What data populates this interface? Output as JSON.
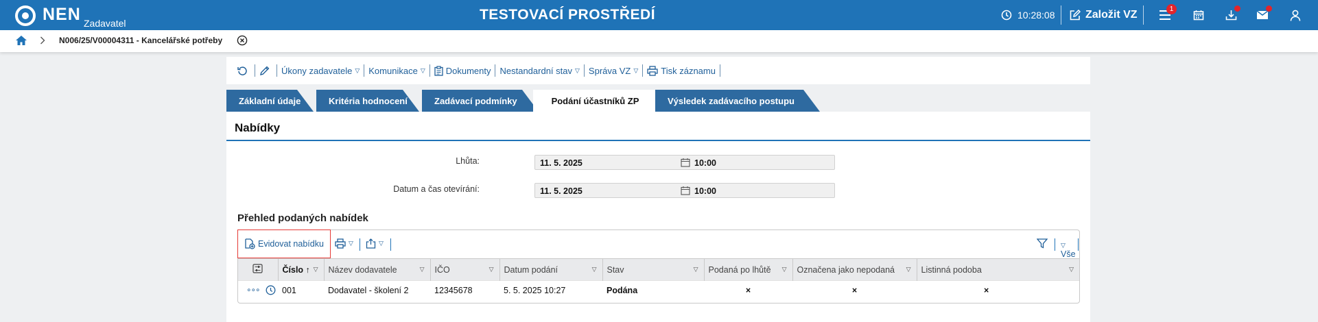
{
  "header": {
    "logo_text": "NEN",
    "logo_sub": "Zadavatel",
    "env_title": "TESTOVACÍ PROSTŘEDÍ",
    "clock": "10:28:08",
    "create_label": "Založit VZ",
    "menu_badge": "1"
  },
  "breadcrumb": {
    "text": "N006/25/V00004311 - Kancelářské potřeby"
  },
  "actions": {
    "ukony": "Úkony zadavatele",
    "komunikace": "Komunikace",
    "dokumenty": "Dokumenty",
    "nestandardni": "Nestandardní stav",
    "sprava": "Správa VZ",
    "tisk": "Tisk záznamu"
  },
  "tabs": [
    {
      "label": "Základní údaje"
    },
    {
      "label": "Kritéria hodnocení"
    },
    {
      "label": "Zadávací podmínky"
    },
    {
      "label": "Podání účastníků ZP",
      "active": true
    },
    {
      "label": "Výsledek zadávacího postupu"
    }
  ],
  "section": {
    "title": "Nabídky",
    "lhuta_label": "Lhůta:",
    "lhuta_date": "11. 5. 2025",
    "lhuta_time": "10:00",
    "otevirani_label": "Datum a čas otevírání:",
    "otevirani_date": "11. 5. 2025",
    "otevirani_time": "10:00"
  },
  "offers": {
    "title": "Přehled podaných nabídek",
    "add_label": "Evidovat nabídku",
    "filter_all": "Vše",
    "columns": [
      "Číslo",
      "Název dodavatele",
      "IČO",
      "Datum podání",
      "Stav",
      "Podaná po lhůtě",
      "Označena jako nepodaná",
      "Listinná podoba"
    ],
    "rows": [
      {
        "cislo": "001",
        "dodavatel": "Dodavatel - školení 2",
        "ico": "12345678",
        "datum": "5. 5. 2025 10:27",
        "stav": "Podána",
        "po_lhute": "×",
        "nepodana": "×",
        "listinna": "×"
      }
    ]
  },
  "colors": {
    "brand": "#1f73b7",
    "tab": "#2e6aa0",
    "link": "#1f5f99",
    "alert": "#e3242b"
  }
}
